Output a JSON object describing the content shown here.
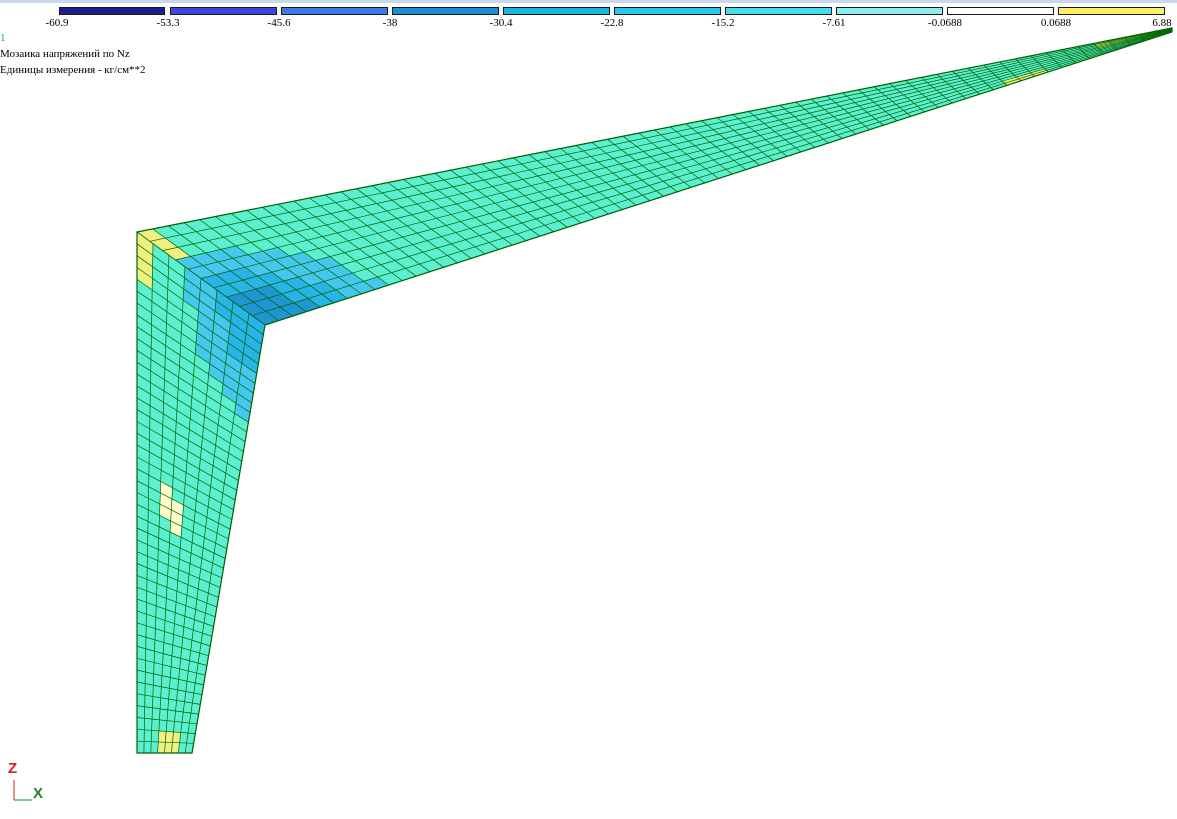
{
  "legend": {
    "values": [
      "-60.9",
      "-53.3",
      "-45.6",
      "-38",
      "-30.4",
      "-22.8",
      "-15.2",
      "-7.61",
      "-0.0688",
      "0.0688",
      "6.88"
    ],
    "colors": [
      "#1e1e8c",
      "#3c46dc",
      "#3c78e6",
      "#1e8cd2",
      "#1eb4e6",
      "#28c8f0",
      "#46dcf0",
      "#8cf0f0",
      "#ffffff",
      "#fff064"
    ]
  },
  "header": {
    "index": "1",
    "title": "Мозаика напряжений по Nz",
    "units": "Единицы измерения - кг/см**2"
  },
  "axes": {
    "z_label": "Z",
    "x_label": "X"
  },
  "mesh_colors": {
    "base": "#5cf0d0",
    "mid": "#46c8ee",
    "high": "#28b4e6",
    "peak": "#1e96d2",
    "yellow": "#f0f080",
    "pale": "#fffccc",
    "line": "#006400"
  }
}
